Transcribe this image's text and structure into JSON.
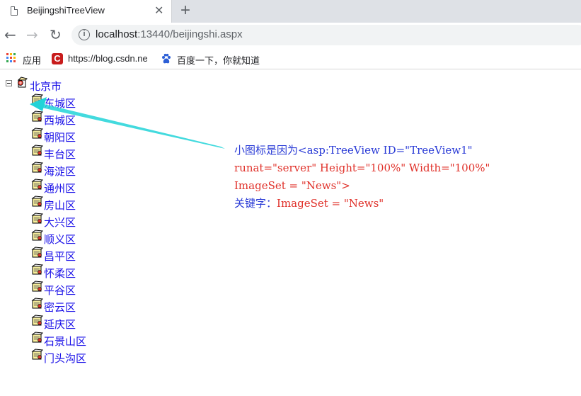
{
  "browser": {
    "tab_title": "BeijingshiTreeView",
    "close_glyph": "✕",
    "new_tab_glyph": "+",
    "back_glyph": "←",
    "forward_glyph": "→",
    "reload_glyph": "↻",
    "url_host": "localhost",
    "url_path": ":13440/beijingshi.aspx"
  },
  "bookmarks": {
    "apps_label": "应用",
    "items": [
      {
        "label": "https://blog.csdn.ne",
        "icon": "csdn-c-icon"
      },
      {
        "label": "百度一下，你就知道",
        "icon": "baidu-paw-icon"
      }
    ]
  },
  "tree": {
    "root": "北京市",
    "children": [
      "东城区",
      "西城区",
      "朝阳区",
      "丰台区",
      "海淀区",
      "通州区",
      "房山区",
      "大兴区",
      "顺义区",
      "昌平区",
      "怀柔区",
      "平谷区",
      "密云区",
      "延庆区",
      "石景山区",
      "门头沟区"
    ]
  },
  "annotation": {
    "line1_prefix": "小图标是因为",
    "line1_code": "<asp:TreeView ID=\"TreeView1\"",
    "line2": "runat=\"server\" Height=\"100%\" Width=\"100%\"",
    "line3": "ImageSet = \"News\">",
    "line4_prefix": "关键字：",
    "line4_code": "ImageSet = \"News\"",
    "arrow_color": "#22d3d8"
  }
}
